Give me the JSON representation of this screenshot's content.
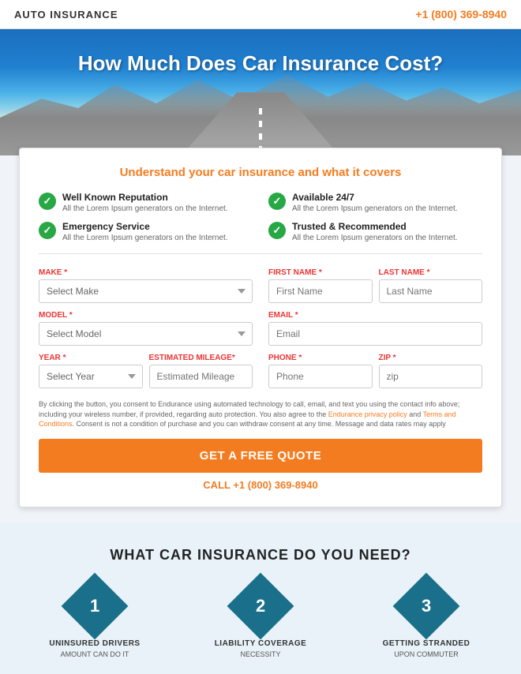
{
  "header": {
    "logo": "AUTO INSURANCE",
    "phone": "+1 (800) 369-8940"
  },
  "hero": {
    "title": "How Much Does Car Insurance Cost?"
  },
  "card": {
    "subtitle_plain": "Understand your ",
    "subtitle_highlight": "car insurance",
    "subtitle_end": " and what it covers",
    "features": [
      {
        "title": "Well Known Reputation",
        "desc": "All the Lorem Ipsum generators on the Internet."
      },
      {
        "title": "Available 24/7",
        "desc": "All the Lorem Ipsum generators on the Internet."
      },
      {
        "title": "Emergency Service",
        "desc": "All the Lorem Ipsum generators on the Internet."
      },
      {
        "title": "Trusted & Recommended",
        "desc": "All the Lorem Ipsum generators on the Internet."
      }
    ],
    "form": {
      "make_label": "MAKE",
      "make_placeholder": "Select Make",
      "model_label": "MODEL",
      "model_placeholder": "Select Model",
      "year_label": "YEAR",
      "year_placeholder": "Select Year",
      "mileage_label": "ESTIMATED MILEAGE",
      "mileage_placeholder": "Estimated Mileage",
      "first_name_label": "FIRST NAME",
      "first_name_placeholder": "First Name",
      "last_name_label": "LAST NAME",
      "last_name_placeholder": "Last Name",
      "email_label": "EMAIL",
      "email_placeholder": "Email",
      "phone_label": "PHONE",
      "phone_placeholder": "Phone",
      "zip_label": "ZIP",
      "zip_placeholder": "zip"
    },
    "disclaimer": "By clicking the button, you consent to Endurance using automated technology to call, email, and text you using the contact info above; including your wireless number, if provided, regarding auto protection. You also agree to the Endurance privacy policy and Terms and Conditions. Consent is not a condition of purchase and you can withdraw consent at any time. Message and data rates may apply",
    "disclaimer_link1": "Endurance privacy policy",
    "disclaimer_link2": "Terms and Conditions",
    "cta_button": "GET A FREE QUOTE",
    "cta_call_prefix": "CALL ",
    "cta_call_number": "+1 (800) 369-8940"
  },
  "bottom": {
    "title": "WHAT CAR INSURANCE DO YOU NEED?",
    "cards": [
      {
        "number": "1",
        "title": "UNINSURED DRIVERS",
        "sub": "AMOUNT CAN DO IT"
      },
      {
        "number": "2",
        "title": "LIABILITY COVERAGE",
        "sub": "NECESSITY"
      },
      {
        "number": "3",
        "title": "GETTING STRANDED",
        "sub": "UPON COMMUTER"
      }
    ]
  }
}
